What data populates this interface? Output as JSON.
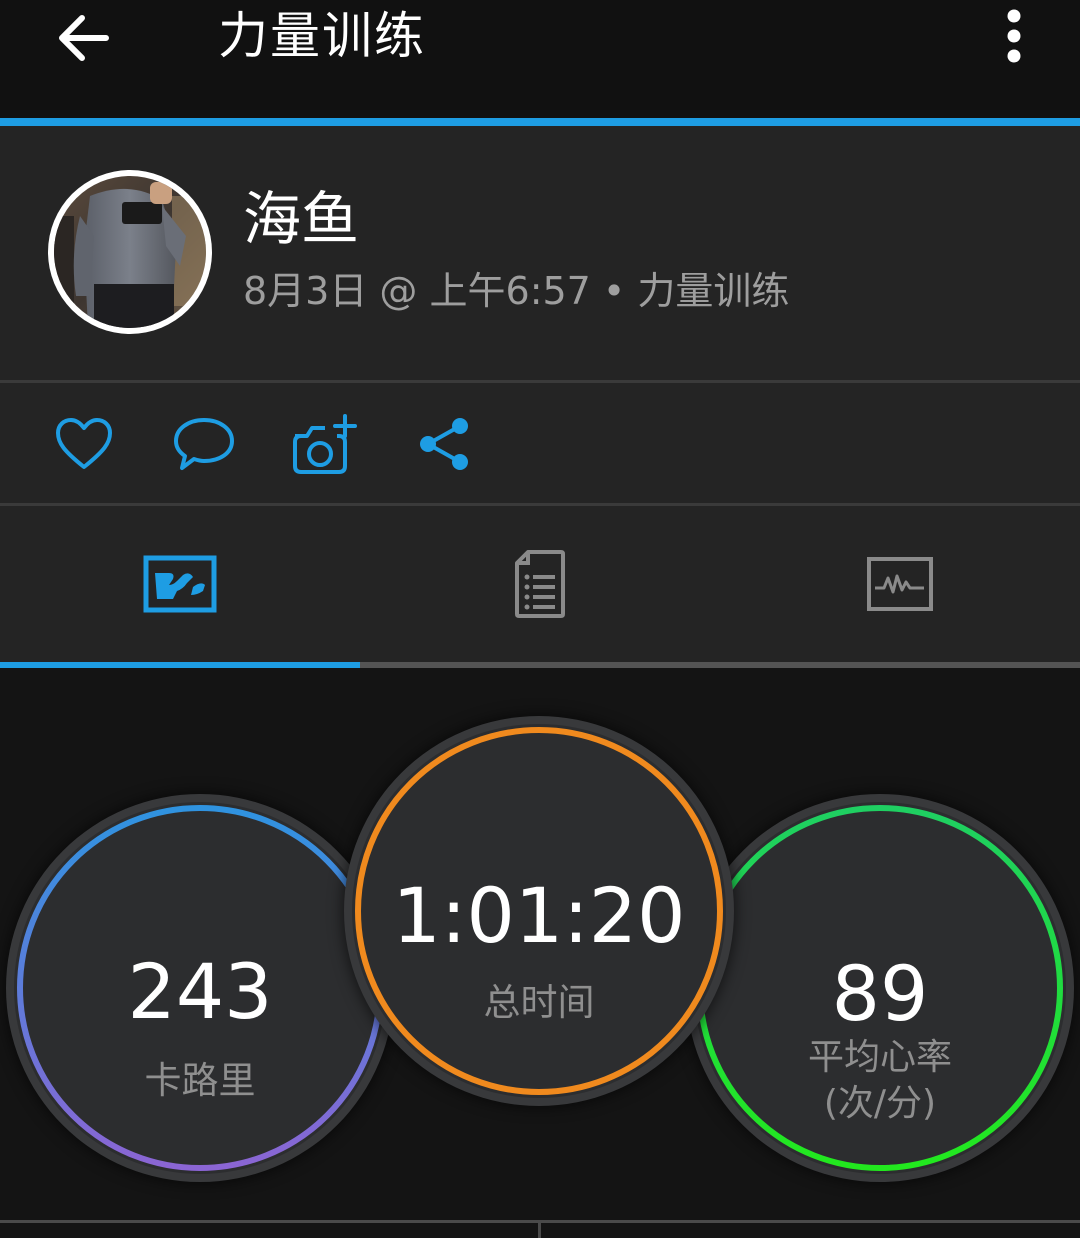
{
  "colors": {
    "accent_blue": "#1e9de3",
    "calories_ring_start": "#2f93e0",
    "calories_ring_end": "#8b65d4",
    "time_ring": "#f08a1e",
    "heart_ring_start": "#1fcf62",
    "heart_ring_end": "#22e81e",
    "panel": "#242424",
    "background": "#111111",
    "secondary_text": "#9e9e9e"
  },
  "header": {
    "title": "力量训练",
    "back_icon": "arrow-left-icon",
    "more_icon": "more-vertical-icon"
  },
  "profile": {
    "name": "海鱼",
    "meta": "8月3日 @ 上午6:57 • 力量训练"
  },
  "social": {
    "icons": [
      "heart-icon",
      "comment-icon",
      "camera-add-icon",
      "share-icon"
    ]
  },
  "tabs": {
    "items": [
      "map-overview-icon",
      "details-list-icon",
      "chart-pulse-icon"
    ],
    "active_index": 0
  },
  "stats": {
    "calories": {
      "value": "243",
      "label": "卡路里"
    },
    "total_time": {
      "value": "1:01:20",
      "label": "总时间"
    },
    "avg_heart_rate": {
      "value": "89",
      "label_line1": "平均心率",
      "label_line2": "(次/分)"
    }
  }
}
